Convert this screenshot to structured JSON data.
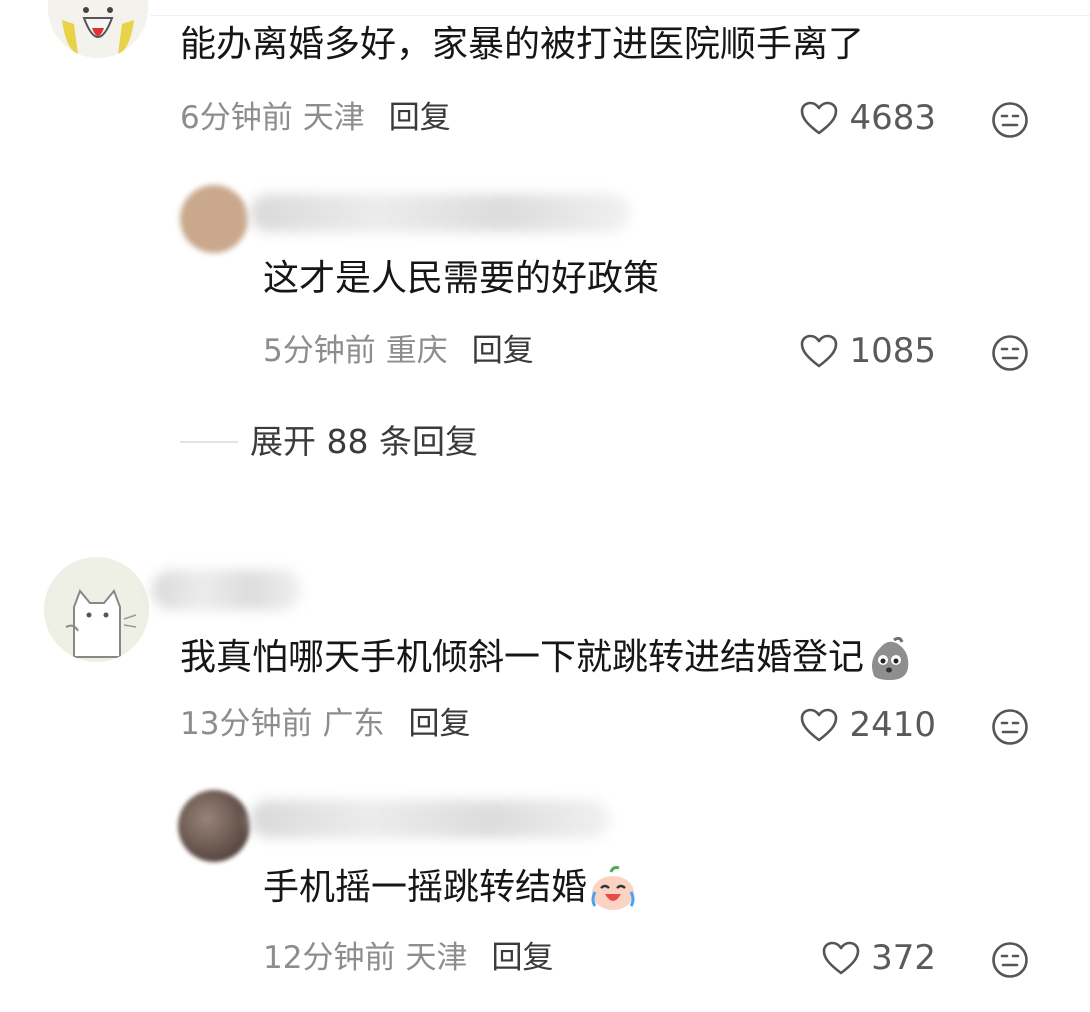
{
  "comments": [
    {
      "text": "能办离婚多好，家暴的被打进医院顺手离了",
      "time": "6分钟前",
      "location": "天津",
      "reply_label": "回复",
      "likes": "4683",
      "replies": [
        {
          "text": "这才是人民需要的好政策",
          "time": "5分钟前",
          "location": "重庆",
          "reply_label": "回复",
          "likes": "1085"
        }
      ],
      "expand_label": "展开 88 条回复"
    },
    {
      "text": "我真怕哪天手机倾斜一下就跳转进结婚登记",
      "emoji": "grey-blob-emoji",
      "time": "13分钟前",
      "location": "广东",
      "reply_label": "回复",
      "likes": "2410",
      "replies": [
        {
          "text": "手机摇一摇跳转结婚",
          "emoji": "laughing-crying-emoji",
          "time": "12分钟前",
          "location": "天津",
          "reply_label": "回复",
          "likes": "372"
        }
      ]
    }
  ],
  "icons": {
    "like": "heart-outline-icon",
    "dislike": "meh-face-icon"
  },
  "colors": {
    "meta_text": "#8d8d8d",
    "reply_text": "#3a3a3a",
    "body_text": "#161616"
  }
}
